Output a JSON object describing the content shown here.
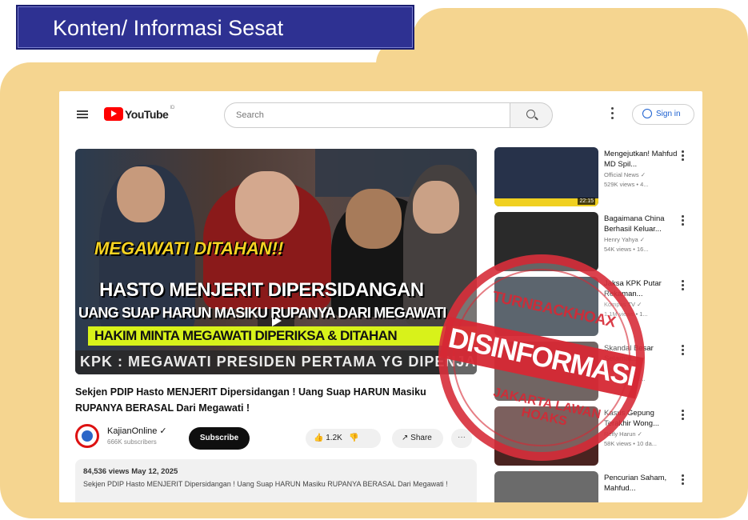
{
  "banner": {
    "title": "Konten/ Informasi Sesat"
  },
  "header": {
    "logo_text": "YouTube",
    "logo_sup": "ID",
    "search_placeholder": "Search",
    "signin_label": "Sign in"
  },
  "video": {
    "overlay_line1": "MEGAWATI DITAHAN!!",
    "overlay_line2": "HASTO MENJERIT DIPERSIDANGAN",
    "overlay_line3": "UANG SUAP HARUN MASIKU RUPANYA DARI MEGAWATI",
    "overlay_line4": "HAKIM MINTA MEGAWATI DIPERIKSA & DITAHAN",
    "overlay_line5": "KPK : MEGAWATI PRESIDEN PERTAMA YG DIPENJARA",
    "title": "Sekjen PDIP Hasto MENJERIT Dipersidangan ! Uang Suap HARUN Masiku RUPANYA BERASAL Dari Megawati !",
    "channel_name": "KajianOnline ✓",
    "channel_subs": "666K subscribers",
    "subscribe_label": "Subscribe",
    "likes": "1.2K",
    "share_label": "Share",
    "more_label": "···",
    "description_meta": "84,536 views  May 12, 2025",
    "description_text": "Sekjen PDIP Hasto MENJERIT Dipersidangan ! Uang Suap HARUN Masiku RUPANYA BERASAL Dari Megawati !"
  },
  "sidebar": {
    "items": [
      {
        "title": "Mengejutkan! Mahfud MD Spil...",
        "channel": "Official News ✓",
        "views": "529K views • 4...",
        "duration": "22:15",
        "color": "#27324a"
      },
      {
        "title": "Bagaimana China Berhasil Keluar...",
        "channel": "Henry Yahya ✓",
        "views": "54K views • 16...",
        "duration": "",
        "color": "#2a2a2a"
      },
      {
        "title": "Jaksa KPK Putar Rekaman...",
        "channel": "Kompas TV ✓",
        "views": "1.1M views • 1...",
        "duration": "",
        "color": "#1e2a36"
      },
      {
        "title": "Skandal Besar Selamat...",
        "channel": "Berita Terkini",
        "views": "88K views • 2...",
        "duration": "",
        "color": "#3b2a28"
      },
      {
        "title": "Kasus Gepung Terakhir Wong...",
        "channel": "Refly Harun ✓",
        "views": "58K views • 10 da...",
        "duration": "",
        "color": "#4a2320"
      },
      {
        "title": "Pencurian Saham, Mahfud...",
        "channel": "",
        "views": "",
        "duration": "",
        "color": "#6b6b6b"
      }
    ]
  },
  "stamp": {
    "top_text": "TURNBACKHOAX",
    "main_text": "DISINFORMASI",
    "bottom_text": "JAKARTA LAWAN HOAKS"
  },
  "colors": {
    "brand_blue": "#2e3192",
    "panel": "#f5d590",
    "stamp_red": "#d62834",
    "yt_red": "#ff0000"
  }
}
